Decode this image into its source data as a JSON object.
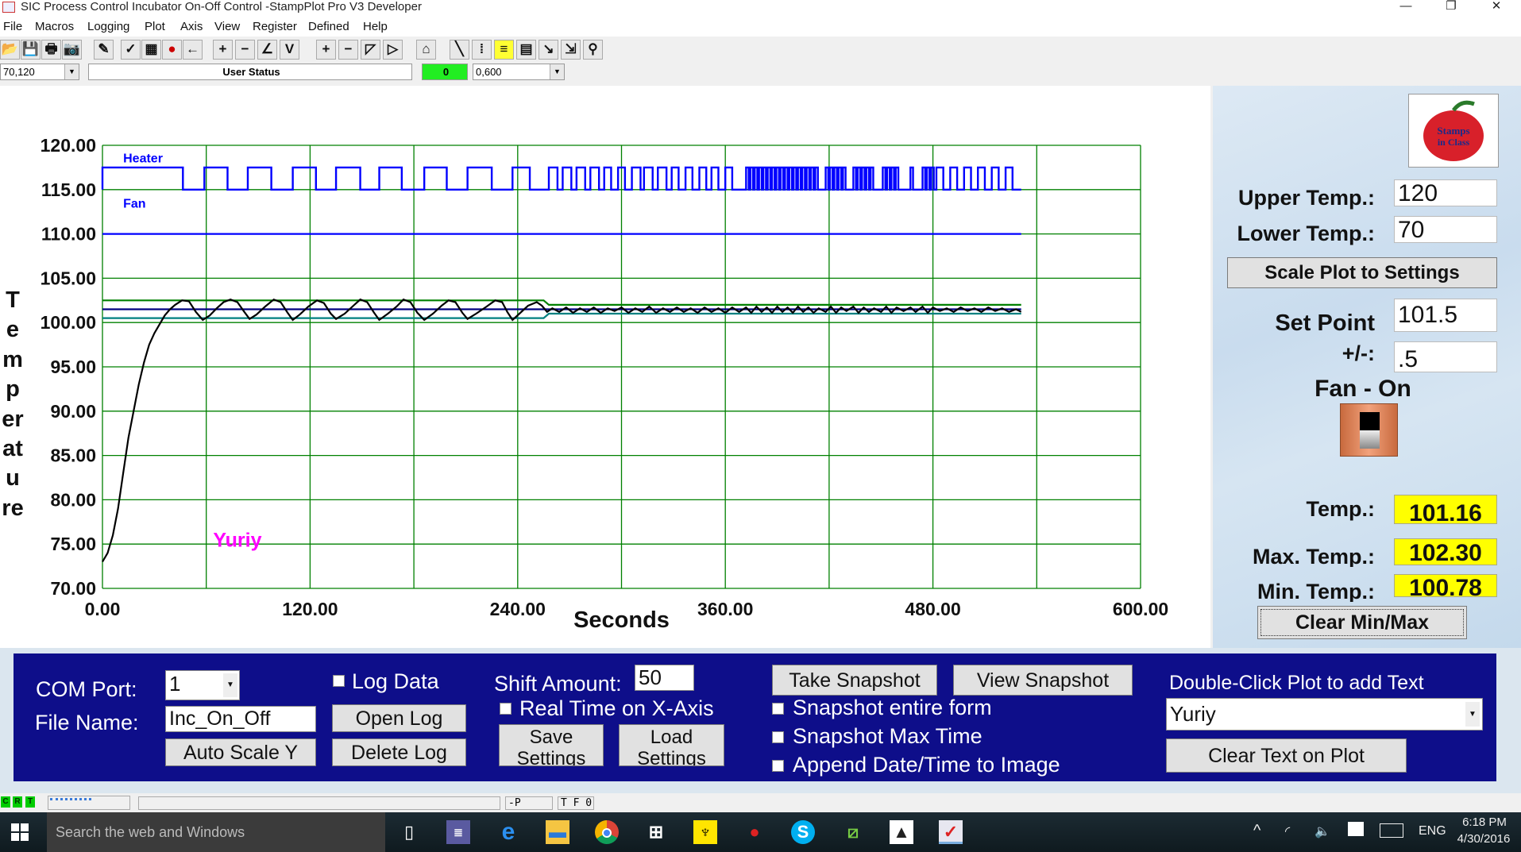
{
  "window": {
    "title": "SIC Process Control Incubator On-Off Control -StampPlot Pro V3 Developer",
    "controls": [
      "—",
      "❐",
      "✕"
    ]
  },
  "menu": [
    "File",
    "Macros",
    "Logging",
    "Plot",
    "Axis",
    "View",
    "Register",
    "Defined",
    "Help"
  ],
  "toolbar": {
    "icons": [
      "open-icon",
      "save-icon",
      "print-icon",
      "camera-icon",
      "wand-icon",
      "plot-tools-icon",
      "data-view-icon",
      "stop-icon",
      "back-arrow-icon",
      "plus-icon",
      "minus-icon",
      "box-slash-icon",
      "box-v-icon",
      "plus-icon",
      "minus-icon",
      "box-icon",
      "box-right-icon",
      "plot-window-icon",
      "pen-icon",
      "markers-icon",
      "note-icon",
      "clipboard-icon",
      "probe-icon",
      "zoom-arrow-icon",
      "wrench-icon"
    ],
    "glyphs": [
      "📂",
      "💾",
      "🖶",
      "📷",
      "✎",
      "✓",
      "▦",
      "●",
      "←",
      "+",
      "−",
      "∠",
      "V",
      "+",
      "−",
      "◸",
      "▷",
      "⌂",
      "╲",
      "⁞",
      "≡",
      "▤",
      "↘",
      "⇲",
      "⚲"
    ],
    "y_range": "70,120",
    "user_status": "User Status",
    "counter": "0",
    "x_range": "0,600",
    "counter_color": "#22ee22"
  },
  "chart_data": {
    "type": "line",
    "xlabel": "Seconds",
    "ylabel": "Temperature",
    "xlim": [
      0,
      600
    ],
    "ylim": [
      70,
      120
    ],
    "x_grid_step": 60,
    "y_grid_step": 5,
    "grid": true,
    "x_ticks": [
      "0.00",
      "120.00",
      "240.00",
      "360.00",
      "480.00",
      "600.00"
    ],
    "x_tick_values": [
      0,
      120,
      240,
      360,
      480,
      600
    ],
    "y_ticks": [
      "120.00",
      "115.00",
      "110.00",
      "105.00",
      "100.00",
      "95.00",
      "90.00",
      "85.00",
      "80.00",
      "75.00",
      "70.00"
    ],
    "y_tick_values": [
      120,
      115,
      110,
      105,
      100,
      95,
      90,
      85,
      80,
      75,
      70
    ],
    "grid_color": "#008000",
    "series": [
      {
        "name": "Heater",
        "kind": "digital",
        "color": "#0000ff",
        "high": 117.5,
        "low": 115,
        "end": 531,
        "on_intervals": [
          [
            0,
            46.5
          ],
          [
            58.9,
            72.3
          ],
          [
            84,
            97.6
          ],
          [
            110,
            123.4
          ],
          [
            135,
            149
          ],
          [
            160,
            173
          ],
          [
            186,
            199
          ],
          [
            211,
            225
          ],
          [
            237,
            247
          ],
          [
            258,
            263
          ],
          [
            266,
            271
          ],
          [
            274,
            279
          ],
          [
            282,
            287
          ],
          [
            290,
            294
          ],
          [
            298,
            302
          ],
          [
            306,
            311
          ],
          [
            313,
            318
          ],
          [
            321,
            326
          ],
          [
            329,
            333
          ],
          [
            337,
            341
          ],
          [
            345,
            349
          ],
          [
            352,
            356
          ],
          [
            360,
            364
          ],
          [
            372,
            373.5
          ],
          [
            374.5,
            376
          ],
          [
            377,
            378.5
          ],
          [
            379.5,
            381
          ],
          [
            382,
            383.5
          ],
          [
            384.5,
            386
          ],
          [
            387,
            388.5
          ],
          [
            389.5,
            391
          ],
          [
            392,
            393.5
          ],
          [
            394.5,
            396
          ],
          [
            397,
            398.5
          ],
          [
            399.5,
            401
          ],
          [
            402,
            403.5
          ],
          [
            404.5,
            406
          ],
          [
            407,
            408.5
          ],
          [
            409.5,
            411
          ],
          [
            412,
            413.5
          ],
          [
            418,
            419.5
          ],
          [
            420.5,
            422
          ],
          [
            423,
            424.5
          ],
          [
            425.5,
            427
          ],
          [
            428,
            429.5
          ],
          [
            434,
            435.5
          ],
          [
            436.5,
            438
          ],
          [
            439,
            440.5
          ],
          [
            441.5,
            443
          ],
          [
            444,
            445.5
          ],
          [
            451,
            452.5
          ],
          [
            453.5,
            455
          ],
          [
            456,
            457.5
          ],
          [
            458.5,
            460
          ],
          [
            467,
            468.5
          ],
          [
            474,
            475.5
          ],
          [
            476.5,
            478
          ],
          [
            479,
            480.5
          ],
          [
            482,
            486
          ],
          [
            490,
            494
          ],
          [
            498,
            502
          ],
          [
            506,
            510
          ],
          [
            514,
            518
          ],
          [
            522,
            526
          ]
        ]
      },
      {
        "name": "Fan",
        "color": "#0000ff",
        "points": [
          [
            0,
            110
          ],
          [
            531,
            110
          ]
        ]
      },
      {
        "color": "#008000",
        "points": [
          [
            0,
            102.5
          ],
          [
            255,
            102.5
          ],
          [
            258,
            102
          ],
          [
            531,
            102
          ]
        ]
      },
      {
        "color": "#000080",
        "points": [
          [
            0,
            101.5
          ],
          [
            531,
            101.5
          ]
        ]
      },
      {
        "color": "#008080",
        "points": [
          [
            0,
            100.5
          ],
          [
            255,
            100.5
          ],
          [
            258,
            101
          ],
          [
            531,
            101
          ]
        ]
      },
      {
        "color": "#000000",
        "points": [
          [
            0,
            73
          ],
          [
            3,
            74
          ],
          [
            6,
            76
          ],
          [
            9,
            79
          ],
          [
            12,
            83
          ],
          [
            15,
            87
          ],
          [
            18,
            90
          ],
          [
            21,
            93
          ],
          [
            24,
            95.5
          ],
          [
            27,
            97.5
          ],
          [
            30,
            98.8
          ],
          [
            33,
            99.8
          ],
          [
            36,
            100.8
          ],
          [
            39,
            101.5
          ],
          [
            42,
            102
          ],
          [
            46,
            102.5
          ],
          [
            50,
            102.4
          ],
          [
            54,
            101.2
          ],
          [
            58,
            100.3
          ],
          [
            62,
            100.8
          ],
          [
            66,
            101.6
          ],
          [
            70,
            102.3
          ],
          [
            74,
            102.6
          ],
          [
            78,
            102.3
          ],
          [
            82,
            101.2
          ],
          [
            85,
            100.4
          ],
          [
            89,
            100.9
          ],
          [
            94,
            101.8
          ],
          [
            99,
            102.6
          ],
          [
            103,
            102.3
          ],
          [
            107,
            101.1
          ],
          [
            110,
            100.3
          ],
          [
            114,
            100.9
          ],
          [
            119,
            101.8
          ],
          [
            124,
            102.5
          ],
          [
            128,
            102.2
          ],
          [
            132,
            101
          ],
          [
            135,
            100.4
          ],
          [
            140,
            101
          ],
          [
            145,
            101.9
          ],
          [
            149,
            102.6
          ],
          [
            153,
            102.3
          ],
          [
            157,
            101.1
          ],
          [
            160,
            100.3
          ],
          [
            165,
            101
          ],
          [
            170,
            101.8
          ],
          [
            174,
            102.6
          ],
          [
            178,
            102.3
          ],
          [
            182,
            101.1
          ],
          [
            186,
            100.3
          ],
          [
            191,
            101
          ],
          [
            196,
            101.9
          ],
          [
            200,
            102.5
          ],
          [
            204,
            102.3
          ],
          [
            208,
            101.1
          ],
          [
            211,
            100.4
          ],
          [
            216,
            101
          ],
          [
            222,
            101.8
          ],
          [
            227,
            102.5
          ],
          [
            231,
            102.3
          ],
          [
            234,
            101.2
          ],
          [
            237,
            100.3
          ],
          [
            241,
            101
          ],
          [
            246,
            101.9
          ],
          [
            251,
            102.3
          ],
          [
            254,
            101.9
          ],
          [
            257,
            101.2
          ],
          [
            260,
            101.6
          ],
          [
            264,
            101.2
          ],
          [
            268,
            101.7
          ],
          [
            272,
            101.1
          ],
          [
            276,
            101.6
          ],
          [
            280,
            101.2
          ],
          [
            284,
            101.7
          ],
          [
            288,
            101.1
          ],
          [
            292,
            101.6
          ],
          [
            296,
            101.3
          ],
          [
            300,
            101.7
          ],
          [
            304,
            101.1
          ],
          [
            308,
            101.6
          ],
          [
            312,
            101.2
          ],
          [
            316,
            101.8
          ],
          [
            320,
            101.1
          ],
          [
            324,
            101.6
          ],
          [
            328,
            101.2
          ],
          [
            332,
            101.7
          ],
          [
            336,
            101.2
          ],
          [
            340,
            101.6
          ],
          [
            344,
            101.1
          ],
          [
            348,
            101.7
          ],
          [
            352,
            101.2
          ],
          [
            356,
            101.6
          ],
          [
            360,
            101.1
          ],
          [
            364,
            101.7
          ],
          [
            368,
            101.2
          ],
          [
            372,
            101.7
          ],
          [
            375,
            101.1
          ],
          [
            378,
            101.8
          ],
          [
            381,
            101.2
          ],
          [
            384,
            101.7
          ],
          [
            387,
            101.1
          ],
          [
            390,
            101.8
          ],
          [
            393,
            101.2
          ],
          [
            396,
            101.7
          ],
          [
            399,
            101.1
          ],
          [
            402,
            101.8
          ],
          [
            405,
            101.2
          ],
          [
            408,
            101.7
          ],
          [
            411,
            101.1
          ],
          [
            414,
            101.6
          ],
          [
            418,
            101.2
          ],
          [
            421,
            101.8
          ],
          [
            424,
            101.1
          ],
          [
            427,
            101.7
          ],
          [
            430,
            101.3
          ],
          [
            434,
            101.8
          ],
          [
            437,
            101.1
          ],
          [
            440,
            101.7
          ],
          [
            443,
            101.2
          ],
          [
            446,
            101.6
          ],
          [
            450,
            101.2
          ],
          [
            453,
            101.8
          ],
          [
            456,
            101.1
          ],
          [
            459,
            101.7
          ],
          [
            463,
            101.3
          ],
          [
            467,
            101.7
          ],
          [
            470,
            101.2
          ],
          [
            474,
            101.8
          ],
          [
            477,
            101.1
          ],
          [
            480,
            101.7
          ],
          [
            484,
            101.3
          ],
          [
            488,
            101.6
          ],
          [
            492,
            101.2
          ],
          [
            496,
            101.7
          ],
          [
            500,
            101.3
          ],
          [
            504,
            101.6
          ],
          [
            508,
            101.2
          ],
          [
            512,
            101.7
          ],
          [
            516,
            101.3
          ],
          [
            520,
            101.6
          ],
          [
            524,
            101.2
          ],
          [
            528,
            101.5
          ],
          [
            531,
            101.2
          ]
        ]
      }
    ],
    "annotations": [
      {
        "text": "Heater",
        "x": 12,
        "y": 118.6,
        "color": "#0000ff"
      },
      {
        "text": "Fan",
        "x": 12,
        "y": 113.5,
        "color": "#0000ff"
      },
      {
        "text": "Yuriy",
        "x": 78,
        "y": 75.5,
        "color": "#ff00ff"
      }
    ]
  },
  "right_panel": {
    "logo_text": "Stamps in Class",
    "upper_label": "Upper Temp.:",
    "upper_value": "120",
    "lower_label": "Lower Temp.:",
    "lower_value": "70",
    "scale_button": "Scale Plot to Settings",
    "setpoint_label": "Set Point",
    "setpoint_value": "101.5",
    "tolerance_label": "+/-:",
    "tolerance_value": ".5",
    "fan_status": "Fan - On",
    "temp_label": "Temp.:",
    "temp_value": "101.16",
    "max_label": "Max. Temp.:",
    "max_value": "102.30",
    "min_label": "Min. Temp.:",
    "min_value": "100.78",
    "clear_button": "Clear Min/Max"
  },
  "bottom_panel": {
    "com_label": "COM Port:",
    "com_value": "1",
    "file_label": "File Name:",
    "file_value": "Inc_On_Off",
    "auto_scale": "Auto Scale Y",
    "log_data": "Log Data",
    "open_log": "Open Log",
    "delete_log": "Delete Log",
    "shift_label": "Shift Amount:",
    "shift_value": "50",
    "real_time": "Real Time on X-Axis",
    "save_settings": "Save Settings",
    "load_settings": "Load Settings",
    "take_snapshot": "Take Snapshot",
    "view_snapshot": "View Snapshot",
    "snap_entire": "Snapshot entire form",
    "snap_max": "Snapshot Max Time",
    "append_date": "Append Date/Time to Image",
    "text_label": "Double-Click Plot to add Text",
    "text_value": "Yuriy",
    "clear_text": "Clear Text on Plot"
  },
  "statusbar": {
    "c": "C",
    "r": "R",
    "t": "T",
    "p": "-P",
    "tf": "T F 0"
  },
  "taskbar": {
    "search": "Search the web and Windows",
    "lang": "ENG",
    "time": "6:18 PM",
    "date": "4/30/2016"
  }
}
